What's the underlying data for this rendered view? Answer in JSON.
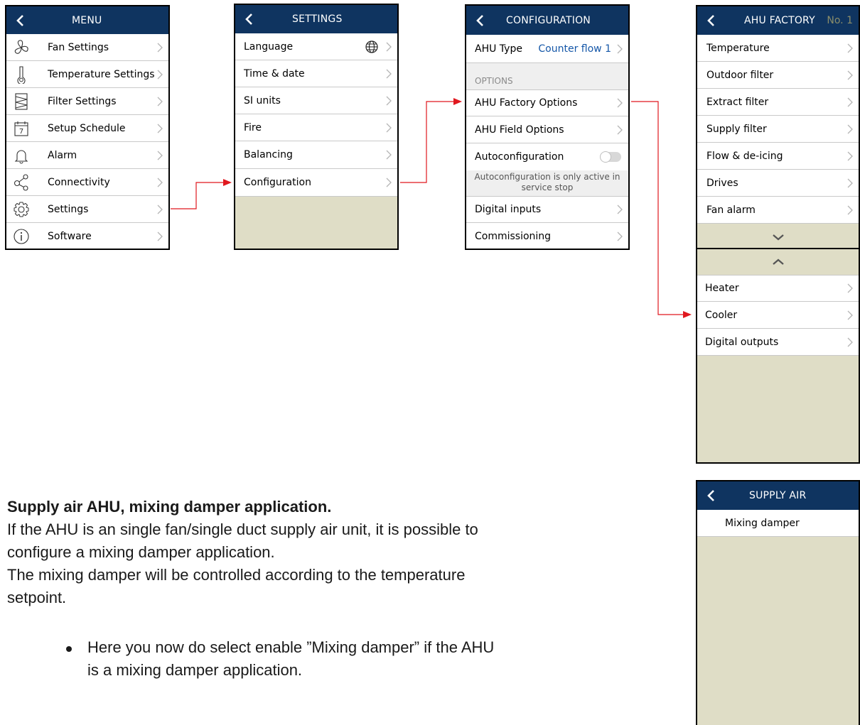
{
  "menu": {
    "title": "MENU",
    "items": [
      {
        "label": "Fan Settings",
        "icon": "fan-icon"
      },
      {
        "label": "Temperature Settings",
        "icon": "thermometer-icon"
      },
      {
        "label": "Filter Settings",
        "icon": "filter-icon"
      },
      {
        "label": "Setup Schedule",
        "icon": "calendar-icon",
        "icon_text": "7"
      },
      {
        "label": "Alarm",
        "icon": "bell-icon"
      },
      {
        "label": "Connectivity",
        "icon": "share-icon"
      },
      {
        "label": "Settings",
        "icon": "gear-icon"
      },
      {
        "label": "Software",
        "icon": "info-icon"
      }
    ]
  },
  "settings": {
    "title": "SETTINGS",
    "items": [
      {
        "label": "Language"
      },
      {
        "label": "Time & date"
      },
      {
        "label": "SI units"
      },
      {
        "label": "Fire"
      },
      {
        "label": "Balancing"
      },
      {
        "label": "Configuration"
      }
    ]
  },
  "configuration": {
    "title": "CONFIGURATION",
    "ahu_type_label": "AHU Type",
    "ahu_type_value": "Counter flow 1",
    "options_label": "OPTIONS",
    "factory_options": "AHU Factory Options",
    "field_options": "AHU Field Options",
    "autoconfig_label": "Autoconfiguration",
    "autoconfig_enabled": false,
    "autoconfig_note_1": "Autoconfiguration is only active in",
    "autoconfig_note_2": "service stop",
    "digital_inputs": "Digital inputs",
    "commissioning": "Commissioning"
  },
  "ahu_factory": {
    "title": "AHU FACTORY",
    "number": "No. 1",
    "items_top": [
      {
        "label": "Temperature"
      },
      {
        "label": "Outdoor filter"
      },
      {
        "label": "Extract filter"
      },
      {
        "label": "Supply filter"
      },
      {
        "label": "Flow & de-icing"
      },
      {
        "label": "Drives"
      },
      {
        "label": "Fan alarm"
      }
    ],
    "items_bottom": [
      {
        "label": "Heater"
      },
      {
        "label": "Cooler"
      },
      {
        "label": "Digital outputs"
      }
    ]
  },
  "supply_air": {
    "title": "SUPPLY AIR",
    "item": "Mixing damper"
  },
  "text": {
    "heading": "Supply air AHU, mixing damper application.",
    "line1": "If the AHU is an single fan/single duct supply air unit, it is possible to",
    "line2": "configure a mixing damper application.",
    "line3": "The mixing damper will be controlled according to the temperature",
    "line4": "setpoint.",
    "bullet1": "Here you now do select enable ”Mixing damper” if the AHU",
    "bullet2": "is a mixing damper application."
  },
  "colors": {
    "header": "#0f3460",
    "panel_bg": "#dfddc6",
    "arrow": "#e0181f",
    "value_text": "#1557a8"
  }
}
